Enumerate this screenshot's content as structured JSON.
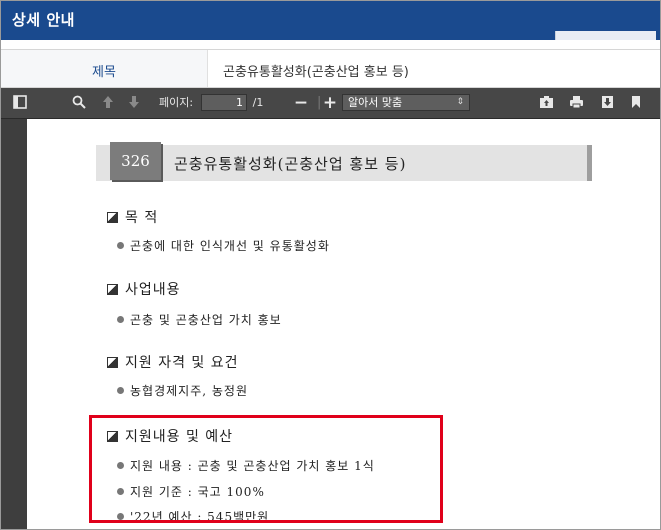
{
  "window": {
    "title": "상세 안내"
  },
  "info": {
    "label": "제목",
    "value": "곤충유통활성화(곤충산업 홍보 등)"
  },
  "toolbar": {
    "page_label": "페이지:",
    "page_current": "1",
    "page_total": "/1",
    "zoom_value": "알아서 맞춤"
  },
  "document": {
    "heading": {
      "number": "326",
      "text": "곤충유통활성화(곤충산업 홍보 등)"
    },
    "sections": [
      {
        "title": "목 적",
        "items": [
          "곤충에 대한 인식개선 및 유통활성화"
        ]
      },
      {
        "title": "사업내용",
        "items": [
          "곤충 및 곤충산업 가치 홍보"
        ]
      },
      {
        "title": "지원 자격 및 요건",
        "items": [
          "농협경제지주, 농정원"
        ]
      },
      {
        "title": "지원내용 및 예산",
        "items": [
          "지원 내용 : 곤충 및 곤충산업 가치 홍보 1식",
          "지원 기준 : 국고 100%",
          "'22년 예산 : 545백만원"
        ]
      }
    ]
  },
  "colors": {
    "titlebar": "#1a4a8e",
    "toolbar": "#474747",
    "highlight": "#e0001a"
  }
}
